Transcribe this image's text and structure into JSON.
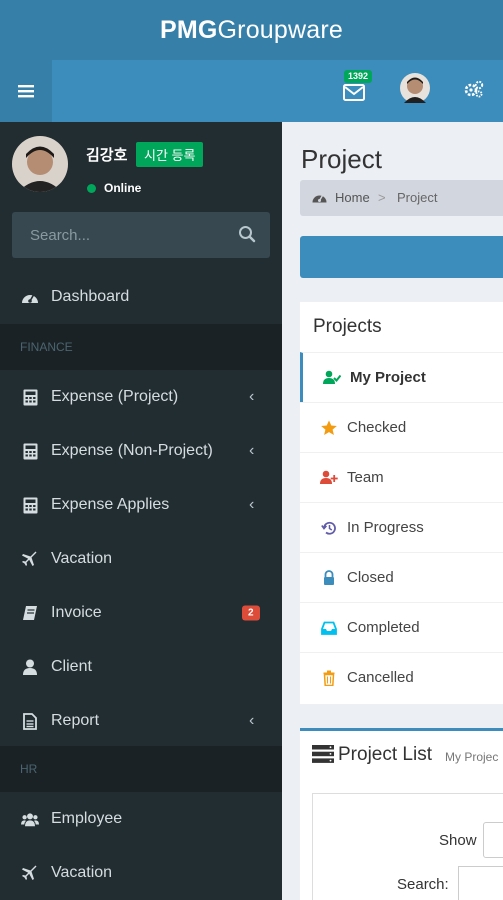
{
  "header": {
    "logo_bold": "PMG",
    "logo_rest": "Groupware",
    "mail_count": "1392"
  },
  "user": {
    "name": "김강호",
    "time_button": "시간 등록",
    "status": "Online"
  },
  "search": {
    "placeholder": "Search..."
  },
  "sidebar": {
    "dashboard": "Dashboard",
    "finance_header": "FINANCE",
    "expense_project": "Expense (Project)",
    "expense_non_project": "Expense (Non-Project)",
    "expense_applies": "Expense Applies",
    "vacation": "Vacation",
    "invoice": "Invoice",
    "invoice_badge": "2",
    "client": "Client",
    "report": "Report",
    "hr_header": "HR",
    "employee": "Employee",
    "hr_vacation": "Vacation"
  },
  "content": {
    "page_title": "Project",
    "breadcrumb_home": "Home",
    "breadcrumb_sep": ">",
    "breadcrumb_current": "Project",
    "projects_title": "Projects",
    "project_items": [
      {
        "label": "My Project"
      },
      {
        "label": "Checked"
      },
      {
        "label": "Team"
      },
      {
        "label": "In Progress"
      },
      {
        "label": "Closed"
      },
      {
        "label": "Completed"
      },
      {
        "label": "Cancelled"
      }
    ],
    "project_list_title": "Project List",
    "project_list_sub": "My Projec",
    "show_label": "Show",
    "search_label": "Search:"
  },
  "colors": {
    "header_dark": "#367fa9",
    "header": "#3c8dbc",
    "sidebar": "#222d32",
    "green": "#00a65a",
    "red_badge": "#dd4b39"
  }
}
